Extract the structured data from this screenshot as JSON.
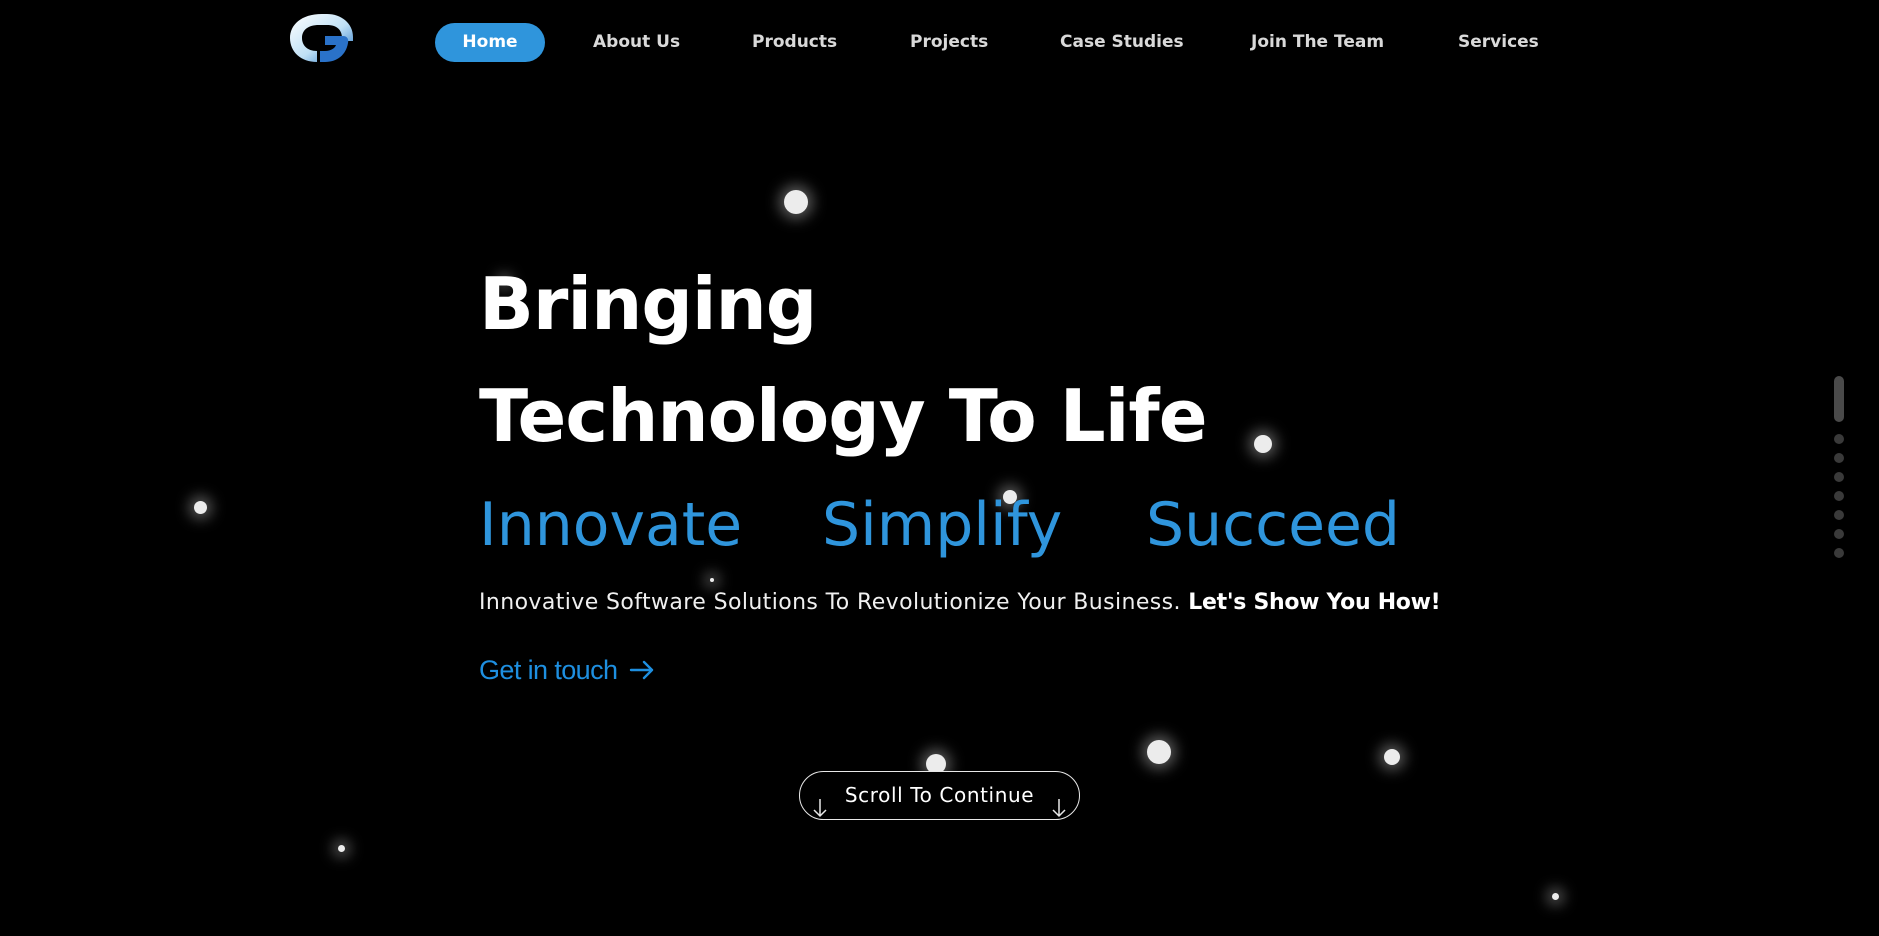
{
  "nav": {
    "logo": "company-logo",
    "items": [
      {
        "label": "Home",
        "active": true
      },
      {
        "label": "About Us",
        "active": false
      },
      {
        "label": "Products",
        "active": false
      },
      {
        "label": "Projects",
        "active": false
      },
      {
        "label": "Case Studies",
        "active": false
      },
      {
        "label": "Join The Team",
        "active": false
      },
      {
        "label": "Services",
        "active": false
      }
    ]
  },
  "hero": {
    "headline_line1": "Bringing",
    "headline_line2": "Technology To Life",
    "words": [
      "Innovate",
      "Simplify",
      "Succeed"
    ],
    "subline_text": "Innovative Software Solutions To Revolutionize Your Business.",
    "subline_emphasis": "Let's Show You How!",
    "cta_label": "Get in touch",
    "cta_icon": "arrow-right-icon",
    "scroll_label": "Scroll To Continue",
    "scroll_icon": "arrow-down-icon"
  },
  "pager": {
    "active_index": 0,
    "count": 8
  },
  "colors": {
    "background": "#000000",
    "accent": "#2f95dc",
    "cta": "#1e8fe0",
    "text": "#ffffff",
    "nav_text": "#d9d9d9"
  }
}
